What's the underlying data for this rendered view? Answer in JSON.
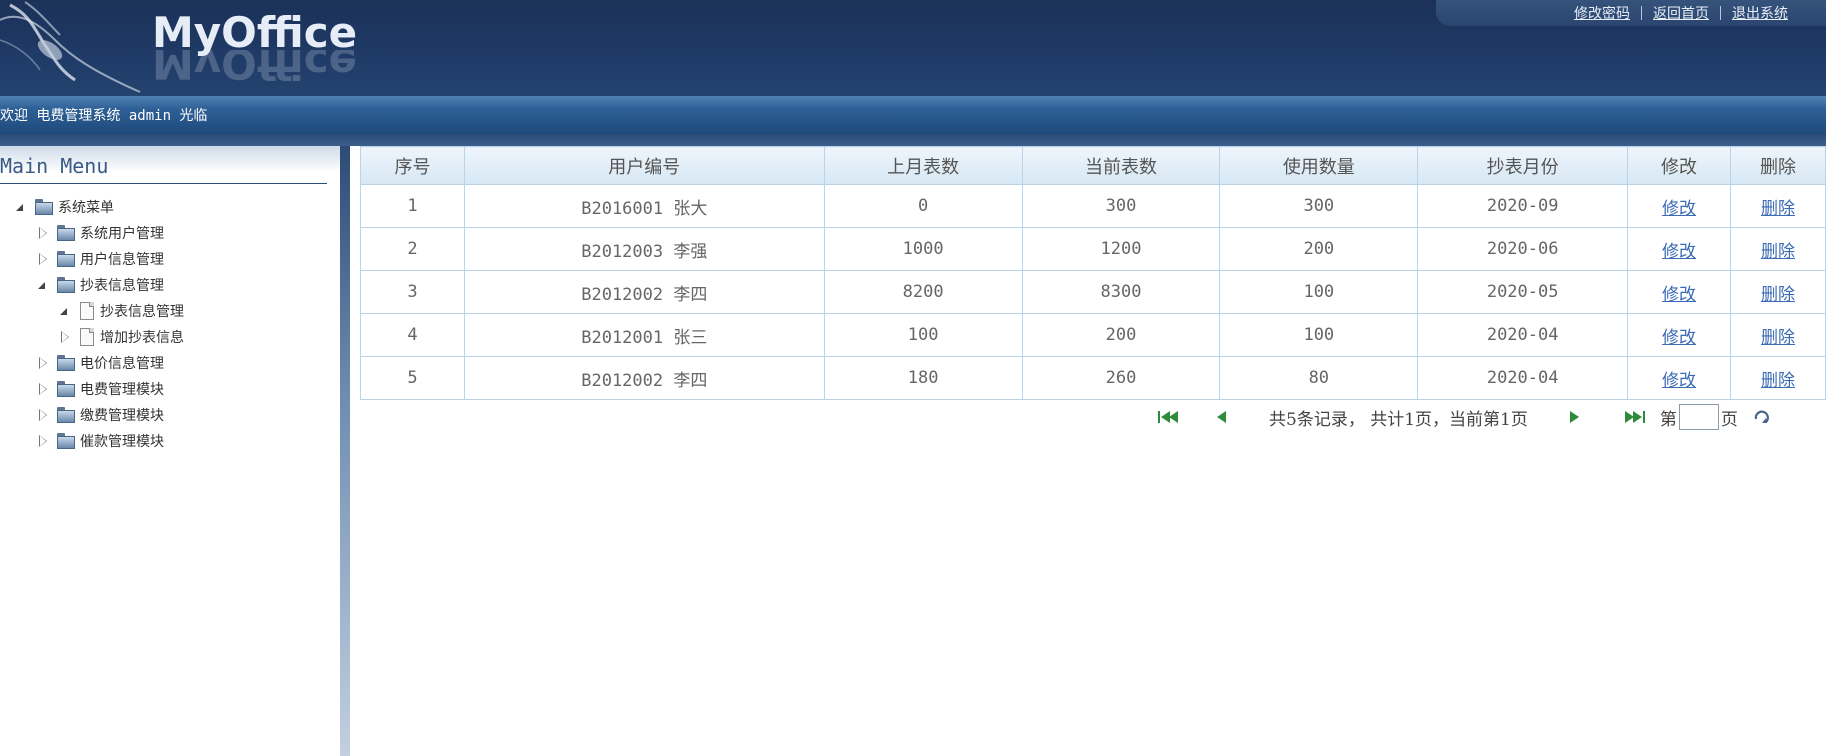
{
  "header": {
    "logo_text": "MyOffice",
    "links": [
      "修改密码",
      "返回首页",
      "退出系统"
    ]
  },
  "welcome": "欢迎 电费管理系统 admin 光临",
  "sidebar": {
    "title": "Main Menu",
    "tree": [
      {
        "label": "系统菜单",
        "level": 0,
        "expanded": true,
        "icon": "folder-icon"
      },
      {
        "label": "系统用户管理",
        "level": 1,
        "expanded": false,
        "icon": "folder-icon"
      },
      {
        "label": "用户信息管理",
        "level": 1,
        "expanded": false,
        "icon": "folder-icon"
      },
      {
        "label": "抄表信息管理",
        "level": 1,
        "expanded": true,
        "icon": "folder-icon"
      },
      {
        "label": "抄表信息管理",
        "level": 2,
        "expanded": true,
        "icon": "document-icon"
      },
      {
        "label": "增加抄表信息",
        "level": 2,
        "expanded": false,
        "icon": "document-icon"
      },
      {
        "label": "电价信息管理",
        "level": 1,
        "expanded": false,
        "icon": "folder-icon"
      },
      {
        "label": "电费管理模块",
        "level": 1,
        "expanded": false,
        "icon": "folder-icon"
      },
      {
        "label": "缴费管理模块",
        "level": 1,
        "expanded": false,
        "icon": "folder-icon"
      },
      {
        "label": "催款管理模块",
        "level": 1,
        "expanded": false,
        "icon": "folder-icon"
      }
    ]
  },
  "table": {
    "headers": [
      "序号",
      "用户编号",
      "上月表数",
      "当前表数",
      "使用数量",
      "抄表月份",
      "修改",
      "删除"
    ],
    "rows": [
      [
        "1",
        "B2016001 张大",
        "0",
        "300",
        "300",
        "2020-09",
        "修改",
        "删除"
      ],
      [
        "2",
        "B2012003 李强",
        "1000",
        "1200",
        "200",
        "2020-06",
        "修改",
        "删除"
      ],
      [
        "3",
        "B2012002 李四",
        "8200",
        "8300",
        "100",
        "2020-05",
        "修改",
        "删除"
      ],
      [
        "4",
        "B2012001 张三",
        "100",
        "200",
        "100",
        "2020-04",
        "修改",
        "删除"
      ],
      [
        "5",
        "B2012002 李四",
        "180",
        "260",
        "80",
        "2020-04",
        "修改",
        "删除"
      ]
    ]
  },
  "pager": {
    "summary": "共5条记录， 共计1页，当前第1页",
    "page_prefix": "第",
    "page_suffix": "页",
    "page_input_value": ""
  },
  "colors": {
    "header_bg": "#1f3a66",
    "welcome_bar": "#2d5f95",
    "table_border": "#b9d3e8",
    "link": "#3a6bb5",
    "pager_arrow": "#2e8b3a"
  }
}
